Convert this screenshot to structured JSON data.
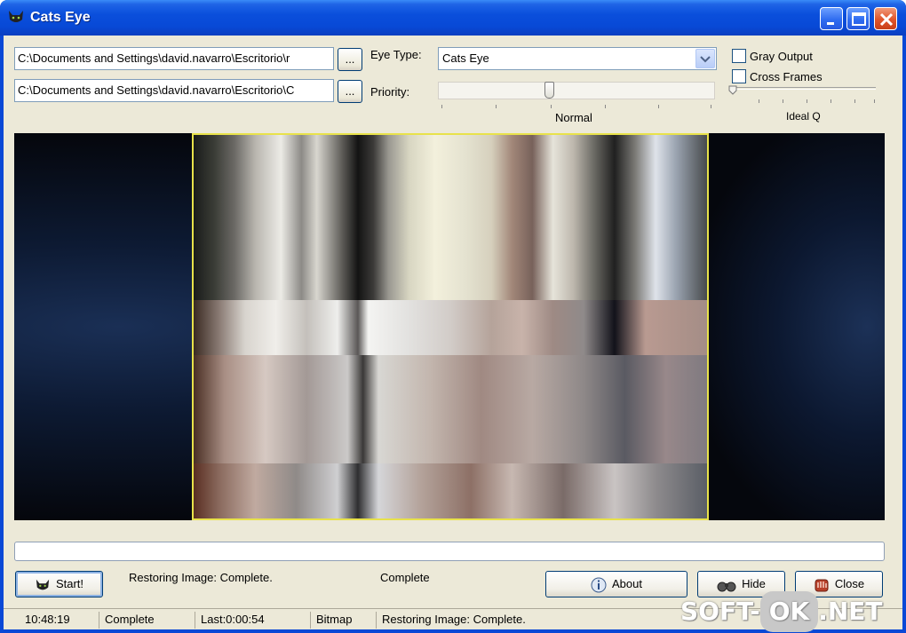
{
  "window": {
    "title": "Cats Eye"
  },
  "paths": {
    "input_path": "C:\\Documents and Settings\\david.navarro\\Escritorio\\r",
    "output_path": "C:\\Documents and Settings\\david.navarro\\Escritorio\\C",
    "browse_label": "..."
  },
  "options": {
    "eye_type_label": "Eye Type:",
    "eye_type_value": "Cats Eye",
    "priority_label": "Priority:",
    "priority_value_label": "Normal",
    "gray_output_label": "Gray Output",
    "gray_output_checked": false,
    "cross_frames_label": "Cross Frames",
    "cross_frames_checked": false,
    "quality_label": "Ideal Q"
  },
  "controls": {
    "start_label": "Start!",
    "restore_status": "Restoring Image: Complete.",
    "status": "Complete",
    "about_label": "About",
    "hide_label": "Hide",
    "close_label": "Close",
    "progress": 0
  },
  "statusbar": {
    "time": "10:48:19",
    "state": "Complete",
    "last": "Last:0:00:54",
    "format": "Bitmap",
    "message": "Restoring Image: Complete."
  },
  "watermark": {
    "left": "SOFT-",
    "middle": "OK",
    "right": ".NET"
  },
  "colors": {
    "title_bar": "#0a4fdc",
    "client_bg": "#ece9d8",
    "image_border": "#e8e24a",
    "preview_bg": "#05070d"
  }
}
